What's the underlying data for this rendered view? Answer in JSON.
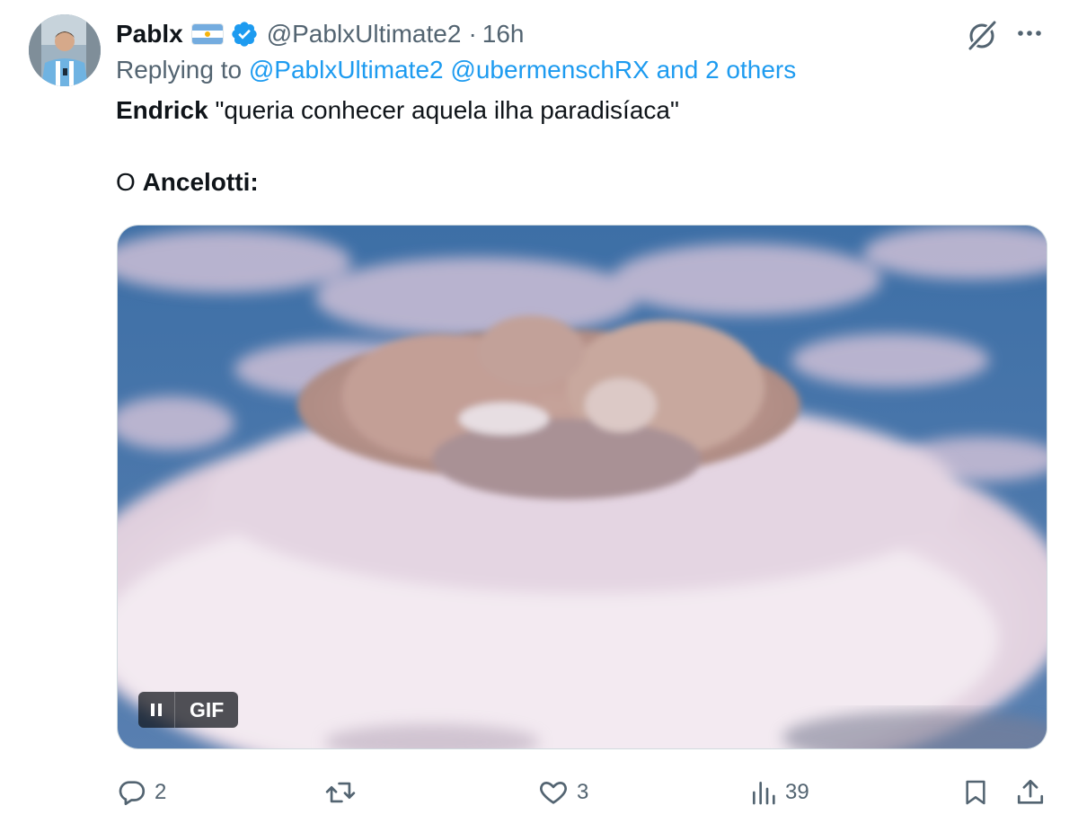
{
  "author": {
    "display_name": "Pablx",
    "handle": "@PablxUltimate2",
    "separator": "·",
    "timestamp": "16h",
    "flag": "argentina-flag",
    "verified_icon": "verified-badge-icon"
  },
  "reply": {
    "prefix": "Replying to",
    "mentions": [
      "@PablxUltimate2",
      "@ubermenschRX"
    ],
    "others": "and 2 others"
  },
  "tweet": {
    "line1_bold": "Endrick",
    "line1_rest": " \"queria conhecer aquela ilha paradisíaca\"",
    "line2_prefix": "O ",
    "line2_bold": "Ancelotti:"
  },
  "media": {
    "type": "gif",
    "badge_label": "GIF"
  },
  "actions": {
    "reply_count": "2",
    "retweet_count": "",
    "like_count": "3",
    "views_count": "39"
  },
  "colors": {
    "link": "#1d9bf0",
    "secondary": "#536471",
    "text": "#0f1419",
    "verified": "#1d9bf0"
  }
}
